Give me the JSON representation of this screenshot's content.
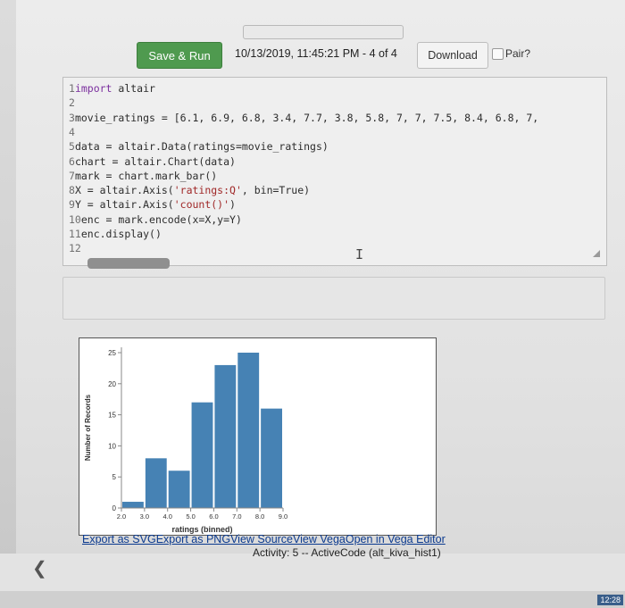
{
  "toolbar": {
    "run_label": "Save & Run",
    "status": "10/13/2019, 11:45:21 PM - 4 of 4",
    "download_label": "Download",
    "pair_label": "Pair?"
  },
  "code": [
    {
      "n": "1",
      "parts": [
        [
          "kw",
          "import"
        ],
        [
          "t",
          " altair"
        ]
      ]
    },
    {
      "n": "2",
      "parts": []
    },
    {
      "n": "3",
      "parts": [
        [
          "t",
          "movie_ratings = [6.1, 6.9, 6.8, 3.4, 7.7, 3.8, 5.8, 7, 7, 7.5, 8.4, 6.8, 7,"
        ]
      ]
    },
    {
      "n": "4",
      "parts": []
    },
    {
      "n": "5",
      "parts": [
        [
          "t",
          "data = altair.Data(ratings=movie_ratings)"
        ]
      ]
    },
    {
      "n": "6",
      "parts": [
        [
          "t",
          "chart = altair.Chart(data)"
        ]
      ]
    },
    {
      "n": "7",
      "parts": [
        [
          "t",
          "mark = chart.mark_bar()"
        ]
      ]
    },
    {
      "n": "8",
      "parts": [
        [
          "t",
          "X = altair.Axis("
        ],
        [
          "str",
          "'ratings:Q'"
        ],
        [
          "t",
          ", bin=True)"
        ]
      ]
    },
    {
      "n": "9",
      "parts": [
        [
          "t",
          "Y = altair.Axis("
        ],
        [
          "str",
          "'count()'"
        ],
        [
          "t",
          ")"
        ]
      ]
    },
    {
      "n": "10",
      "parts": [
        [
          "t",
          "enc = mark.encode(x=X,y=Y)"
        ]
      ]
    },
    {
      "n": "11",
      "parts": [
        [
          "t",
          "enc.display()"
        ]
      ]
    },
    {
      "n": "12",
      "parts": []
    }
  ],
  "chart_data": {
    "type": "bar",
    "bins": [
      [
        2,
        3
      ],
      [
        3,
        4
      ],
      [
        4,
        5
      ],
      [
        5,
        6
      ],
      [
        6,
        7
      ],
      [
        7,
        8
      ],
      [
        8,
        9
      ]
    ],
    "values": [
      1,
      8,
      6,
      17,
      23,
      25,
      16
    ],
    "x_ticks": [
      "2.0",
      "3.0",
      "4.0",
      "5.0",
      "6.0",
      "7.0",
      "8.0",
      "9.0"
    ],
    "y_ticks": [
      "0",
      "5",
      "10",
      "15",
      "20",
      "25"
    ],
    "xlabel": "ratings (binned)",
    "ylabel": "Number of Records",
    "xlim": [
      2,
      9
    ],
    "ylim": [
      0,
      25
    ],
    "bar_color": "#4682b4"
  },
  "export_links": {
    "svg": "Export as SVG",
    "png": "Export as PNG",
    "source": "View Source",
    "vega": "View Vega",
    "editor": "Open in Vega Editor"
  },
  "activity": "Activity: 5 -- ActiveCode (alt_kiva_hist1)",
  "clock": "12:28"
}
